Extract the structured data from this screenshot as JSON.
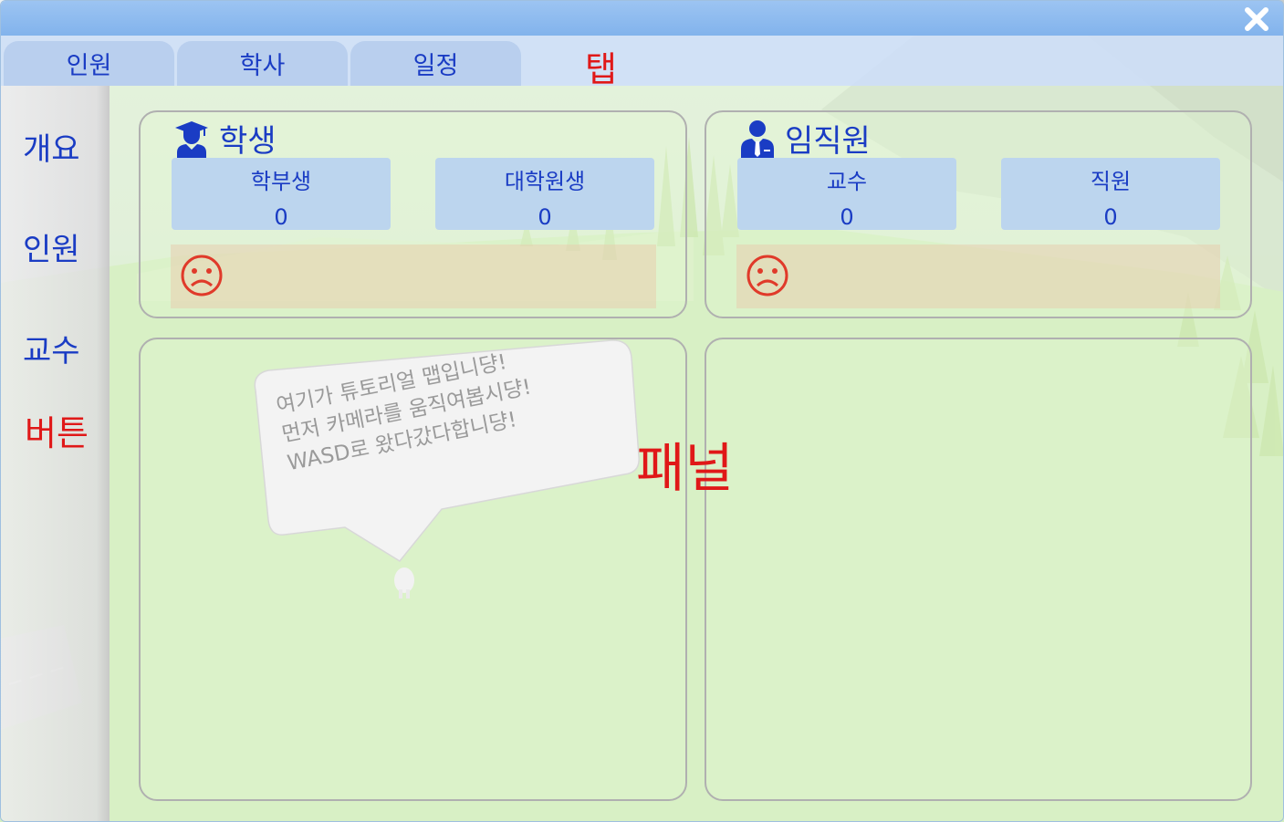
{
  "window": {
    "close_icon": "close-icon"
  },
  "tabs": [
    {
      "label": "인원"
    },
    {
      "label": "학사"
    },
    {
      "label": "일정"
    }
  ],
  "tab_annotation": "탭",
  "sidebar": {
    "items": [
      {
        "label": "개요"
      },
      {
        "label": "인원"
      },
      {
        "label": "교수"
      }
    ],
    "annotation": "버튼"
  },
  "panels": {
    "students": {
      "title": "학생",
      "icon": "graduate-icon",
      "stats": [
        {
          "label": "학부생",
          "value": "0"
        },
        {
          "label": "대학원생",
          "value": "0"
        }
      ],
      "mood_icon": "sad-face-icon"
    },
    "staff": {
      "title": "임직원",
      "icon": "employee-icon",
      "stats": [
        {
          "label": "교수",
          "value": "0"
        },
        {
          "label": "직원",
          "value": "0"
        }
      ],
      "mood_icon": "sad-face-icon"
    }
  },
  "speech_bubble": {
    "lines": [
      "여기가 튜토리얼 맵입니댱!",
      "먼저 카메라를 움직여봅시댱!",
      "WASD로 왔다갔다합니댱!"
    ]
  },
  "panel_annotation": "패널",
  "colors": {
    "accent_text": "#1a3cc4",
    "annotation_red": "#e01818",
    "titlebar": "#8bb9ef",
    "tab": "#b9cfee",
    "stat_card": "#bcd5ee",
    "sad_face": "#e03a2a"
  }
}
